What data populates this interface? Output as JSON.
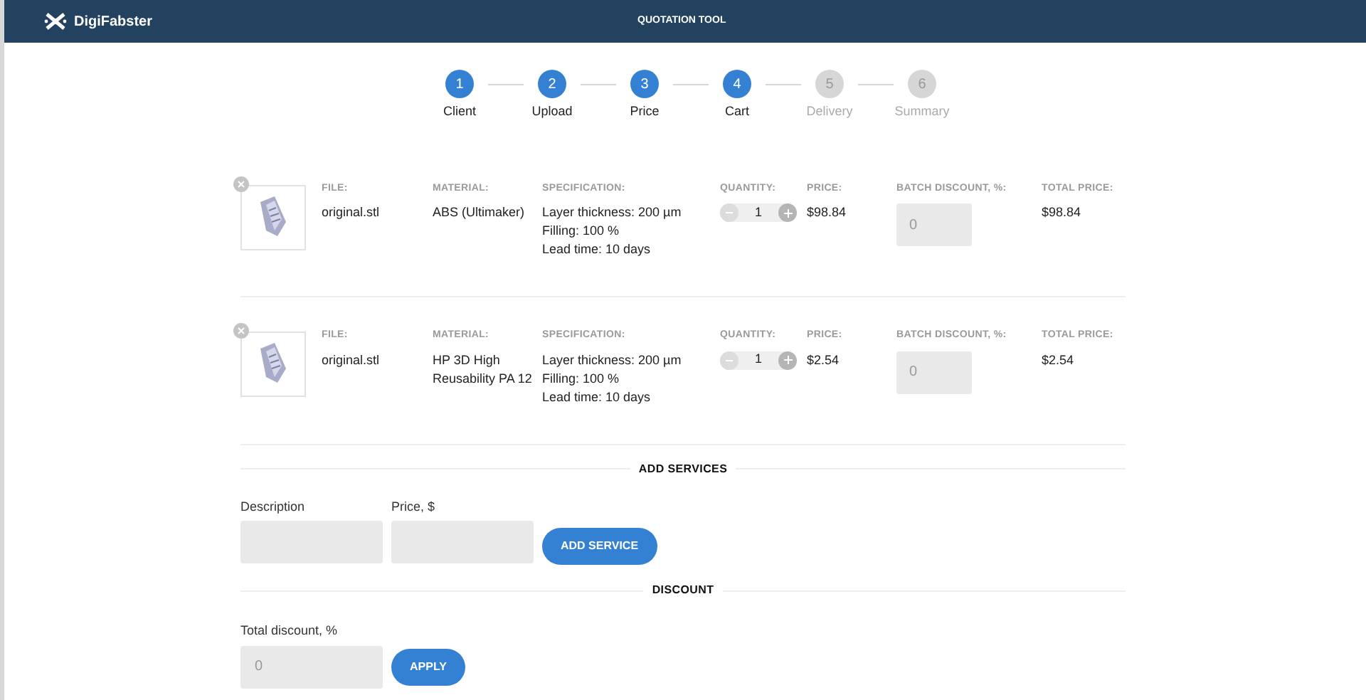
{
  "header": {
    "brand": "DigiFabster",
    "title": "QUOTATION TOOL"
  },
  "steps": [
    {
      "number": "1",
      "label": "Client",
      "done": true
    },
    {
      "number": "2",
      "label": "Upload",
      "done": true
    },
    {
      "number": "3",
      "label": "Price",
      "done": true
    },
    {
      "number": "4",
      "label": "Cart",
      "done": true
    },
    {
      "number": "5",
      "label": "Delivery",
      "done": false
    },
    {
      "number": "6",
      "label": "Summary",
      "done": false
    }
  ],
  "cart_items": [
    {
      "file_label": "FILE:",
      "file": "original.stl",
      "material_label": "MATERIAL:",
      "material": "ABS (Ultimaker)",
      "spec_label": "SPECIFICATION:",
      "spec": [
        "Layer thickness: 200 µm",
        "Filling: 100 %",
        "Lead time: 10 days"
      ],
      "quantity_label": "QUANTITY:",
      "quantity": "1",
      "price_label": "PRICE:",
      "price": "$98.84",
      "batch_label": "BATCH DISCOUNT, %:",
      "batch_placeholder": "0",
      "total_label": "TOTAL PRICE:",
      "total": "$98.84"
    },
    {
      "file_label": "FILE:",
      "file": "original.stl",
      "material_label": "MATERIAL:",
      "material": "HP 3D High Reusability PA 12",
      "spec_label": "SPECIFICATION:",
      "spec": [
        "Layer thickness: 200 µm",
        "Filling: 100 %",
        "Lead time: 10 days"
      ],
      "quantity_label": "QUANTITY:",
      "quantity": "1",
      "price_label": "PRICE:",
      "price": "$2.54",
      "batch_label": "BATCH DISCOUNT, %:",
      "batch_placeholder": "0",
      "total_label": "TOTAL PRICE:",
      "total": "$2.54"
    }
  ],
  "add_services": {
    "heading": "ADD SERVICES",
    "description_label": "Description",
    "price_label": "Price, $",
    "button": "ADD SERVICE"
  },
  "discount": {
    "heading": "DISCOUNT",
    "label": "Total discount, %",
    "placeholder": "0",
    "button": "APPLY"
  }
}
